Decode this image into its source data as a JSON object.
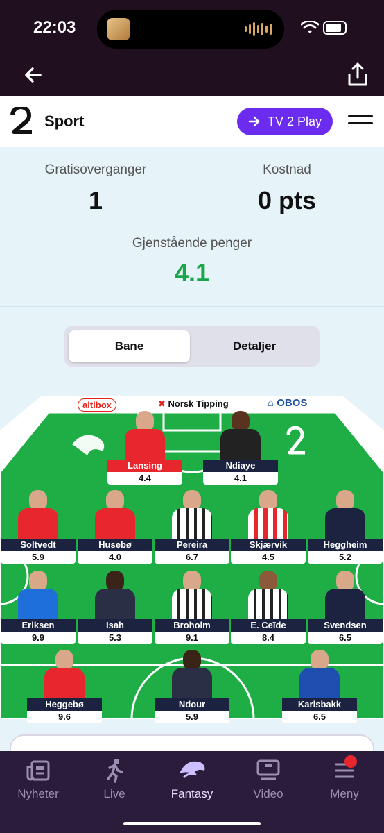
{
  "status_bar": {
    "time": "22:03"
  },
  "header": {
    "brand": "Sport",
    "cta_label": "TV 2 Play"
  },
  "stats": {
    "free_transfers_label": "Gratisoverganger",
    "free_transfers_value": "1",
    "cost_label": "Kostnad",
    "cost_value": "0 pts",
    "money_left_label": "Gjenstående penger",
    "money_left_value": "4.1"
  },
  "segmented": {
    "active": "Bane",
    "inactive": "Detaljer"
  },
  "sponsors": {
    "a": "altibox",
    "b": "Norsk Tipping",
    "c": "OBOS"
  },
  "players": {
    "gk1": {
      "name": "Lansing",
      "price": "4.4"
    },
    "gk2": {
      "name": "Ndiaye",
      "price": "4.1"
    },
    "d1": {
      "name": "Soltvedt",
      "price": "5.9"
    },
    "d2": {
      "name": "Husebø",
      "price": "4.0"
    },
    "d3": {
      "name": "Pereira",
      "price": "6.7"
    },
    "d4": {
      "name": "Skjærvik",
      "price": "4.5"
    },
    "d5": {
      "name": "Heggheim",
      "price": "5.2"
    },
    "m1": {
      "name": "Eriksen",
      "price": "9.9"
    },
    "m2": {
      "name": "Isah",
      "price": "5.3"
    },
    "m3": {
      "name": "Broholm",
      "price": "9.1"
    },
    "m4": {
      "name": "E. Ceïde",
      "price": "8.4"
    },
    "m5": {
      "name": "Svendsen",
      "price": "6.5"
    },
    "f1": {
      "name": "Heggebø",
      "price": "9.6"
    },
    "f2": {
      "name": "Ndour",
      "price": "5.9"
    },
    "f3": {
      "name": "Karlsbakk",
      "price": "6.5"
    }
  },
  "tabs": {
    "news": "Nyheter",
    "live": "Live",
    "fantasy": "Fantasy",
    "video": "Video",
    "menu": "Meny"
  },
  "colors": {
    "accent": "#6b2cf0",
    "pitch": "#1fae46",
    "money": "#19a64a",
    "tab_bar": "#2a1c3a"
  }
}
